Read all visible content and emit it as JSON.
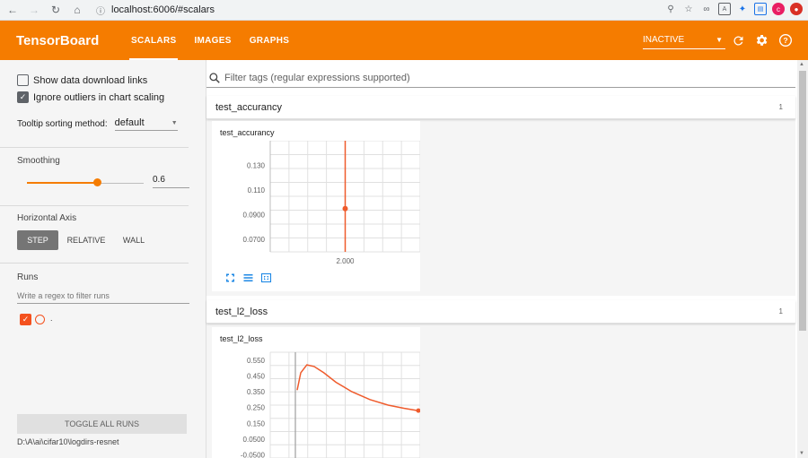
{
  "browser": {
    "url": "localhost:6006/#scalars"
  },
  "appbar": {
    "brand": "TensorBoard",
    "tabs": [
      "SCALARS",
      "IMAGES",
      "GRAPHS"
    ],
    "active_tab": "SCALARS",
    "status_select": "INACTIVE",
    "accent_color": "#f57c00"
  },
  "sidebar": {
    "show_download_label": "Show data download links",
    "show_download_checked": false,
    "ignore_outliers_label": "Ignore outliers in chart scaling",
    "ignore_outliers_checked": true,
    "tooltip_sort_label": "Tooltip sorting method:",
    "tooltip_sort_value": "default",
    "smoothing_label": "Smoothing",
    "smoothing_value": "0.6",
    "smoothing_fraction": 0.6,
    "horizontal_axis_label": "Horizontal Axis",
    "axis_options": [
      "STEP",
      "RELATIVE",
      "WALL"
    ],
    "axis_selected": "STEP",
    "runs_label": "Runs",
    "runs_filter_placeholder": "Write a regex to filter runs",
    "run_name": ".",
    "toggle_all_label": "TOGGLE ALL RUNS",
    "logdir": "D:\\A\\ai\\cifar10\\logdirs-resnet"
  },
  "main": {
    "filter_placeholder": "Filter tags (regular expressions supported)",
    "categories": [
      {
        "name": "test_accurancy",
        "count": "1",
        "card_title": "test_accurancy"
      },
      {
        "name": "test_l2_loss",
        "count": "1",
        "card_title": "test_l2_loss"
      }
    ]
  },
  "chart_data": [
    {
      "type": "scatter",
      "title": "test_accurancy",
      "x_ticks": [
        "2.000"
      ],
      "y_ticks": [
        "0.130",
        "0.110",
        "0.0900",
        "0.0700"
      ],
      "ylim": [
        0.06,
        0.15
      ],
      "series": [
        {
          "x": [
            2.0
          ],
          "y": [
            0.095
          ]
        }
      ],
      "grid": true,
      "color": "#ef5b2c"
    },
    {
      "type": "line",
      "title": "test_l2_loss",
      "y_ticks": [
        "0.550",
        "0.450",
        "0.350",
        "0.250",
        "0.150",
        "0.0500",
        "-0.0500"
      ],
      "ylim": [
        -0.07,
        0.6
      ],
      "series": [
        {
          "x": [
            0,
            0.03,
            0.08,
            0.14,
            0.22,
            0.32,
            0.45,
            0.6,
            0.75,
            0.88,
            1.0
          ],
          "y": [
            0.36,
            0.47,
            0.52,
            0.51,
            0.47,
            0.41,
            0.35,
            0.3,
            0.265,
            0.245,
            0.23
          ]
        }
      ],
      "grid": true,
      "color": "#ef5b2c"
    }
  ]
}
